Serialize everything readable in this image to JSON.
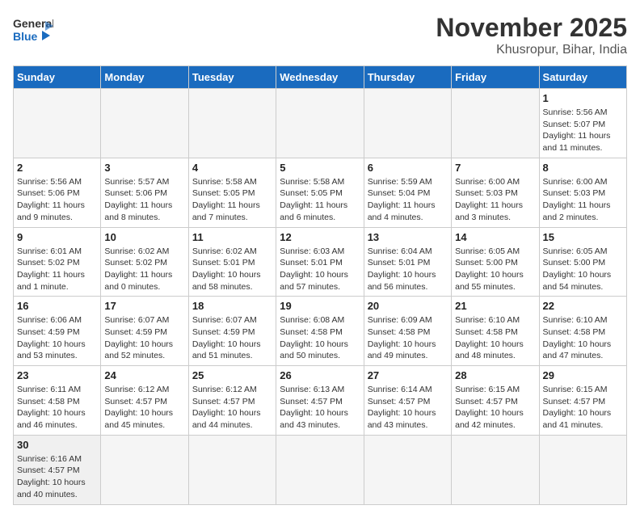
{
  "header": {
    "logo_general": "General",
    "logo_blue": "Blue",
    "month_title": "November 2025",
    "location": "Khusropur, Bihar, India"
  },
  "weekdays": [
    "Sunday",
    "Monday",
    "Tuesday",
    "Wednesday",
    "Thursday",
    "Friday",
    "Saturday"
  ],
  "weeks": [
    [
      {
        "day": "",
        "info": ""
      },
      {
        "day": "",
        "info": ""
      },
      {
        "day": "",
        "info": ""
      },
      {
        "day": "",
        "info": ""
      },
      {
        "day": "",
        "info": ""
      },
      {
        "day": "",
        "info": ""
      },
      {
        "day": "1",
        "info": "Sunrise: 5:56 AM\nSunset: 5:07 PM\nDaylight: 11 hours\nand 11 minutes."
      }
    ],
    [
      {
        "day": "2",
        "info": "Sunrise: 5:56 AM\nSunset: 5:06 PM\nDaylight: 11 hours\nand 9 minutes."
      },
      {
        "day": "3",
        "info": "Sunrise: 5:57 AM\nSunset: 5:06 PM\nDaylight: 11 hours\nand 8 minutes."
      },
      {
        "day": "4",
        "info": "Sunrise: 5:58 AM\nSunset: 5:05 PM\nDaylight: 11 hours\nand 7 minutes."
      },
      {
        "day": "5",
        "info": "Sunrise: 5:58 AM\nSunset: 5:05 PM\nDaylight: 11 hours\nand 6 minutes."
      },
      {
        "day": "6",
        "info": "Sunrise: 5:59 AM\nSunset: 5:04 PM\nDaylight: 11 hours\nand 4 minutes."
      },
      {
        "day": "7",
        "info": "Sunrise: 6:00 AM\nSunset: 5:03 PM\nDaylight: 11 hours\nand 3 minutes."
      },
      {
        "day": "8",
        "info": "Sunrise: 6:00 AM\nSunset: 5:03 PM\nDaylight: 11 hours\nand 2 minutes."
      }
    ],
    [
      {
        "day": "9",
        "info": "Sunrise: 6:01 AM\nSunset: 5:02 PM\nDaylight: 11 hours\nand 1 minute."
      },
      {
        "day": "10",
        "info": "Sunrise: 6:02 AM\nSunset: 5:02 PM\nDaylight: 11 hours\nand 0 minutes."
      },
      {
        "day": "11",
        "info": "Sunrise: 6:02 AM\nSunset: 5:01 PM\nDaylight: 10 hours\nand 58 minutes."
      },
      {
        "day": "12",
        "info": "Sunrise: 6:03 AM\nSunset: 5:01 PM\nDaylight: 10 hours\nand 57 minutes."
      },
      {
        "day": "13",
        "info": "Sunrise: 6:04 AM\nSunset: 5:01 PM\nDaylight: 10 hours\nand 56 minutes."
      },
      {
        "day": "14",
        "info": "Sunrise: 6:05 AM\nSunset: 5:00 PM\nDaylight: 10 hours\nand 55 minutes."
      },
      {
        "day": "15",
        "info": "Sunrise: 6:05 AM\nSunset: 5:00 PM\nDaylight: 10 hours\nand 54 minutes."
      }
    ],
    [
      {
        "day": "16",
        "info": "Sunrise: 6:06 AM\nSunset: 4:59 PM\nDaylight: 10 hours\nand 53 minutes."
      },
      {
        "day": "17",
        "info": "Sunrise: 6:07 AM\nSunset: 4:59 PM\nDaylight: 10 hours\nand 52 minutes."
      },
      {
        "day": "18",
        "info": "Sunrise: 6:07 AM\nSunset: 4:59 PM\nDaylight: 10 hours\nand 51 minutes."
      },
      {
        "day": "19",
        "info": "Sunrise: 6:08 AM\nSunset: 4:58 PM\nDaylight: 10 hours\nand 50 minutes."
      },
      {
        "day": "20",
        "info": "Sunrise: 6:09 AM\nSunset: 4:58 PM\nDaylight: 10 hours\nand 49 minutes."
      },
      {
        "day": "21",
        "info": "Sunrise: 6:10 AM\nSunset: 4:58 PM\nDaylight: 10 hours\nand 48 minutes."
      },
      {
        "day": "22",
        "info": "Sunrise: 6:10 AM\nSunset: 4:58 PM\nDaylight: 10 hours\nand 47 minutes."
      }
    ],
    [
      {
        "day": "23",
        "info": "Sunrise: 6:11 AM\nSunset: 4:58 PM\nDaylight: 10 hours\nand 46 minutes."
      },
      {
        "day": "24",
        "info": "Sunrise: 6:12 AM\nSunset: 4:57 PM\nDaylight: 10 hours\nand 45 minutes."
      },
      {
        "day": "25",
        "info": "Sunrise: 6:12 AM\nSunset: 4:57 PM\nDaylight: 10 hours\nand 44 minutes."
      },
      {
        "day": "26",
        "info": "Sunrise: 6:13 AM\nSunset: 4:57 PM\nDaylight: 10 hours\nand 43 minutes."
      },
      {
        "day": "27",
        "info": "Sunrise: 6:14 AM\nSunset: 4:57 PM\nDaylight: 10 hours\nand 43 minutes."
      },
      {
        "day": "28",
        "info": "Sunrise: 6:15 AM\nSunset: 4:57 PM\nDaylight: 10 hours\nand 42 minutes."
      },
      {
        "day": "29",
        "info": "Sunrise: 6:15 AM\nSunset: 4:57 PM\nDaylight: 10 hours\nand 41 minutes."
      }
    ],
    [
      {
        "day": "30",
        "info": "Sunrise: 6:16 AM\nSunset: 4:57 PM\nDaylight: 10 hours\nand 40 minutes."
      },
      {
        "day": "",
        "info": ""
      },
      {
        "day": "",
        "info": ""
      },
      {
        "day": "",
        "info": ""
      },
      {
        "day": "",
        "info": ""
      },
      {
        "day": "",
        "info": ""
      },
      {
        "day": "",
        "info": ""
      }
    ]
  ]
}
